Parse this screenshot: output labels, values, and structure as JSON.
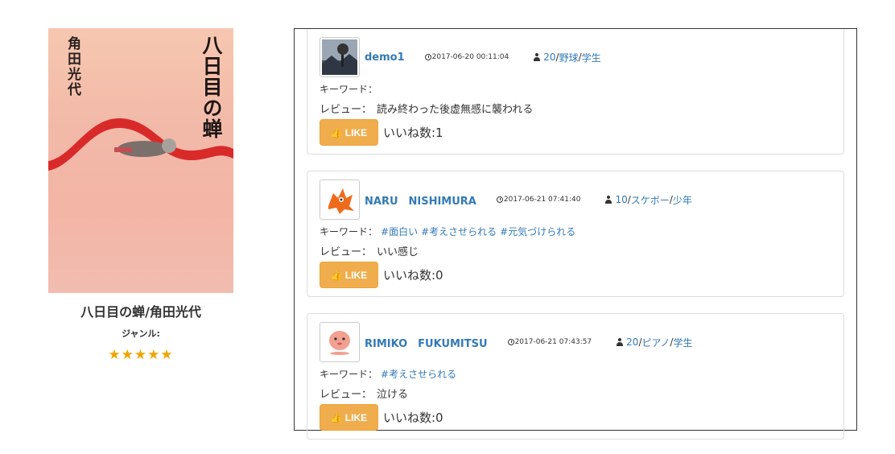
{
  "book": {
    "cover_author": "角田光代",
    "cover_title": "八日目の蝉",
    "title": "八日目の蝉/角田光代",
    "genre_label": "ジャンル:",
    "rating": 5,
    "stars": "★★★★★"
  },
  "reviews": [
    {
      "user": "demo1",
      "avatar_icon": "mountain-tree-avatar",
      "timestamp": "2017-06-20 00:11:04",
      "age": "20",
      "hobby": "野球",
      "occupation": "学生",
      "keyword_label": "キーワード：",
      "keywords": [],
      "review_label": "レビュー：",
      "review_text": "読み終わった後虚無感に襲われる",
      "like_label": "LIKE",
      "like_count_text": "いいね数:1"
    },
    {
      "user": "NARU　NISHIMURA",
      "avatar_icon": "orange-dragon-avatar",
      "timestamp": "2017-06-21 07:41:40",
      "age": "10",
      "hobby": "スケボー",
      "occupation": "少年",
      "keyword_label": "キーワード：",
      "keywords": [
        "#面白い",
        "#考えさせられる",
        "#元気づけられる"
      ],
      "review_label": "レビュー：",
      "review_text": "いい感じ",
      "like_label": "LIKE",
      "like_count_text": "いいね数:0"
    },
    {
      "user": "RIMIKO　FUKUMITSU",
      "avatar_icon": "pink-creature-avatar",
      "timestamp": "2017-06-21 07:43:57",
      "age": "20",
      "hobby": "ピアノ",
      "occupation": "学生",
      "keyword_label": "キーワード：",
      "keywords": [
        "#考えさせられる"
      ],
      "review_label": "レビュー：",
      "review_text": "泣ける",
      "like_label": "LIKE",
      "like_count_text": "いいね数:0"
    }
  ],
  "colors": {
    "link": "#337ab7",
    "like_button": "#f0ad4e",
    "star": "#f0a500"
  }
}
